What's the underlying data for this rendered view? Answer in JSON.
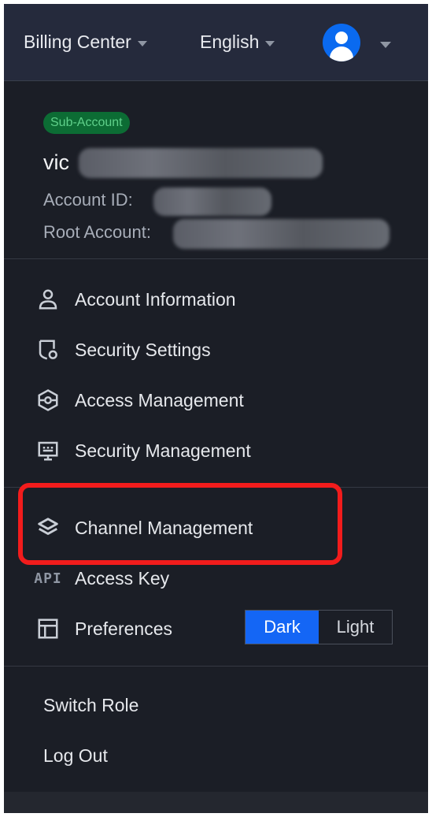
{
  "topbar": {
    "billing_label": "Billing Center",
    "language_label": "English",
    "avatar_icon": "user-avatar-icon"
  },
  "account": {
    "badge": "Sub-Account",
    "username_visible": "vic",
    "account_id_label": "Account ID:",
    "root_account_label": "Root Account:"
  },
  "nav": {
    "group1": [
      {
        "label": "Account Information",
        "icon": "user-icon"
      },
      {
        "label": "Security Settings",
        "icon": "security-settings-icon"
      },
      {
        "label": "Access Management",
        "icon": "access-management-icon"
      },
      {
        "label": "Security Management",
        "icon": "security-management-icon"
      }
    ],
    "group2": [
      {
        "label": "Channel Management",
        "icon": "layers-icon"
      },
      {
        "label": "Access Key",
        "icon": "api-icon",
        "icon_text": "API"
      },
      {
        "label": "Preferences",
        "icon": "layout-icon"
      }
    ]
  },
  "theme": {
    "dark": "Dark",
    "light": "Light",
    "selected": "Dark"
  },
  "footer": {
    "switch_role": "Switch Role",
    "log_out": "Log Out"
  },
  "colors": {
    "panel_bg": "#1b1e26",
    "topbar_bg": "#252a3c",
    "accent": "#1466f5",
    "badge_bg": "#0c6c34",
    "badge_text": "#5fd08a",
    "highlight_border": "#f21c1c"
  }
}
